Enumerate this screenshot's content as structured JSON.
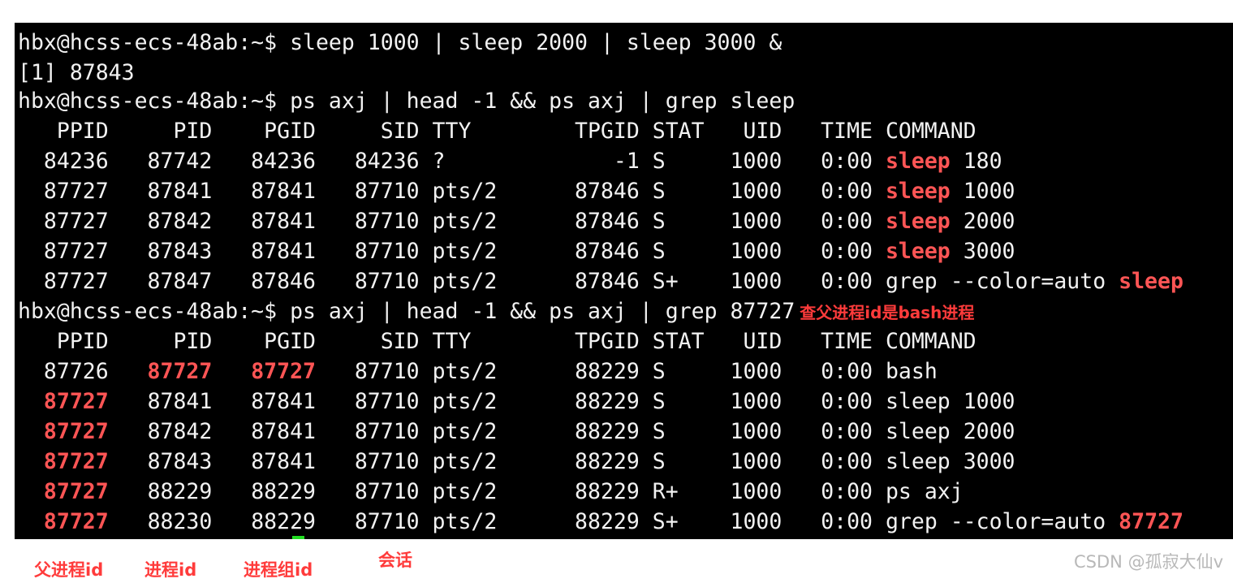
{
  "terminal": {
    "background": "#000000",
    "foreground": "#f2f2f2",
    "highlight": "#ff5555",
    "prompt": "hbx@hcss-ecs-48ab:~$",
    "cmd1": "sleep 1000 | sleep 2000 | sleep 3000 &",
    "job_output": "[1] 87843",
    "cmd2": "ps axj | head -1 && ps axj | grep sleep",
    "header": "   PPID     PID    PGID     SID TTY        TPGID STAT   UID   TIME COMMAND",
    "grep_sleep_rows": [
      {
        "prefix": "  84236   87742   84236   84236 ?             -1 S     1000   0:00 ",
        "keyword": "sleep",
        "suffix": " 180"
      },
      {
        "prefix": "  87727   87841   87841   87710 pts/2      87846 S     1000   0:00 ",
        "keyword": "sleep",
        "suffix": " 1000"
      },
      {
        "prefix": "  87727   87842   87841   87710 pts/2      87846 S     1000   0:00 ",
        "keyword": "sleep",
        "suffix": " 2000"
      },
      {
        "prefix": "  87727   87843   87841   87710 pts/2      87846 S     1000   0:00 ",
        "keyword": "sleep",
        "suffix": " 3000"
      },
      {
        "prefix": "  87727   87847   87846   87710 pts/2      87846 S+    1000   0:00 grep --color=auto ",
        "keyword": "sleep",
        "suffix": ""
      }
    ],
    "cmd3": "ps axj | head -1 && ps axj | grep 87727",
    "cmd3_annotation": "查父进程id是bash进程",
    "bash_row": {
      "ppid": "  87726   ",
      "pid": "87727",
      "gap": "   ",
      "pgid": "87727",
      "rest": "   87710 pts/2      88229 S     1000   0:00 bash"
    },
    "grep_ppid_rows": [
      {
        "ppid": "87727",
        "rest": "   87841   87841   87710 pts/2      88229 S     1000   0:00 sleep 1000"
      },
      {
        "ppid": "87727",
        "rest": "   87842   87841   87710 pts/2      88229 S     1000   0:00 sleep 2000"
      },
      {
        "ppid": "87727",
        "rest": "   87843   87841   87710 pts/2      88229 S     1000   0:00 sleep 3000"
      },
      {
        "ppid": "87727",
        "rest": "   88229   88229   87710 pts/2      88229 R+    1000   0:00 ps axj"
      }
    ],
    "last_row": {
      "ppid": "87727",
      "rest": "   88230   88229   87710 pts/2      88229 S+    1000   0:00 grep --color=auto ",
      "keyword": "87727"
    }
  },
  "captions": {
    "ppid": "父进程id",
    "pid": "进程id",
    "pgid": "进程组id",
    "sid": "会话"
  },
  "watermark": "CSDN @孤寂大仙v"
}
